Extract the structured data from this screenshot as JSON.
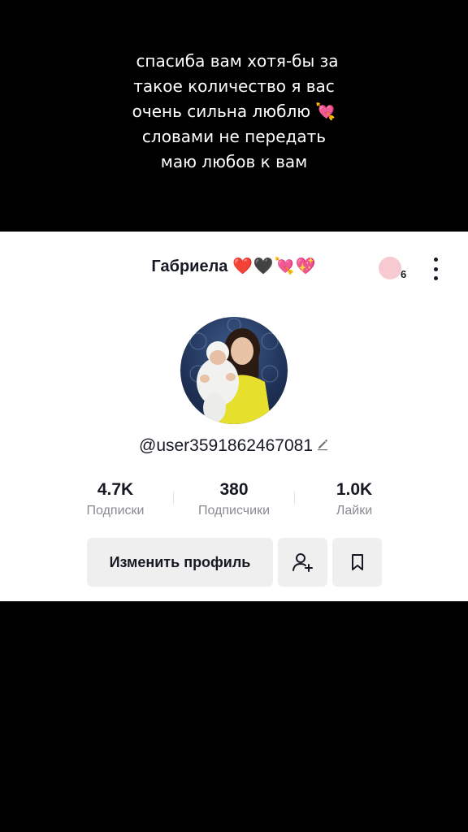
{
  "caption": {
    "lines": [
      "спасиба вам хотя-бы за",
      "такое количество я вас",
      "очень сильна люблю 💘",
      "словами не передать",
      "маю любов к вам"
    ]
  },
  "profile": {
    "display_name": "Габриела",
    "display_name_emojis": "❤️🖤💘💖",
    "notification_count": "6",
    "username": "@user3591862467081",
    "stats": [
      {
        "value": "4.7K",
        "label": "Подписки"
      },
      {
        "value": "380",
        "label": "Подписчики"
      },
      {
        "value": "1.0K",
        "label": "Лайки"
      }
    ],
    "edit_button_label": "Изменить профиль"
  },
  "icons": {
    "more": "more-vertical-icon",
    "edit": "pencil-icon",
    "add_friend": "add-friend-icon",
    "bookmark": "bookmark-icon"
  },
  "colors": {
    "background": "#000000",
    "card": "#ffffff",
    "text_primary": "#161823",
    "text_secondary": "#8a8b91",
    "button_bg": "#efeff0"
  }
}
